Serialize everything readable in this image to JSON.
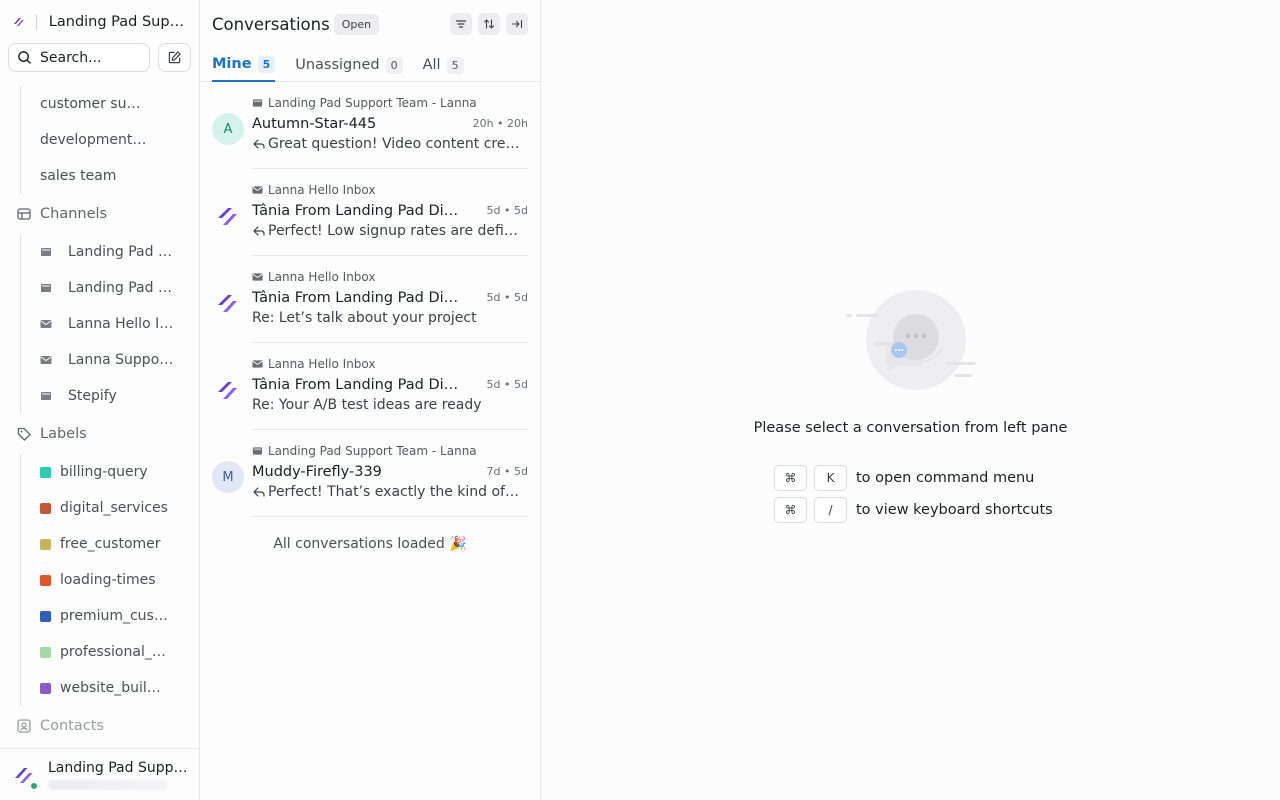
{
  "brand": {
    "name": "Landing Pad Support"
  },
  "search": {
    "placeholder": "Search..."
  },
  "sidebar": {
    "teams": [
      "customer support",
      "development team",
      "sales team"
    ],
    "channels_label": "Channels",
    "channels": [
      {
        "label": "Landing Pad Support Team",
        "icon": "widget-icon"
      },
      {
        "label": "Landing Pad Support",
        "icon": "widget-icon"
      },
      {
        "label": "Lanna Hello Inbox",
        "icon": "mail-icon"
      },
      {
        "label": "Lanna Support Inbox",
        "icon": "mail-icon"
      },
      {
        "label": "Stepify",
        "icon": "widget-icon"
      }
    ],
    "labels_label": "Labels",
    "labels": [
      {
        "label": "billing-query",
        "color": "#2ecbb1"
      },
      {
        "label": "digital_services",
        "color": "#c4573a"
      },
      {
        "label": "free_customer",
        "color": "#c9b35a"
      },
      {
        "label": "loading-times",
        "color": "#e0542b"
      },
      {
        "label": "premium_customer",
        "color": "#2f5fb8"
      },
      {
        "label": "professional_customer",
        "color": "#a6d9a2"
      },
      {
        "label": "website_builder",
        "color": "#8a5bc4"
      }
    ],
    "contacts_label": "Contacts"
  },
  "account": {
    "name": "Landing Pad Support"
  },
  "list": {
    "title": "Conversations",
    "status_badge": "Open",
    "tabs": [
      {
        "label": "Mine",
        "count": "5"
      },
      {
        "label": "Unassigned",
        "count": "0"
      },
      {
        "label": "All",
        "count": "5"
      }
    ],
    "conversations": [
      {
        "avatar": "A",
        "avatar_type": "letter",
        "inbox": "Landing Pad Support Team - Lanna",
        "inbox_icon": "widget-icon",
        "name": "Autumn-Star-445",
        "time": "20h • 20h",
        "reply": true,
        "message": "Great question! Video content creation for landing pages"
      },
      {
        "avatar": "",
        "avatar_type": "logo",
        "inbox": "Lanna Hello Inbox",
        "inbox_icon": "mail-icon",
        "name": "Tânia From Landing Pad Digital",
        "time": "5d • 5d",
        "reply": true,
        "message": "Perfect! Low signup rates are definitely fixable"
      },
      {
        "avatar": "",
        "avatar_type": "logo",
        "inbox": "Lanna Hello Inbox",
        "inbox_icon": "mail-icon",
        "name": "Tânia From Landing Pad Digital",
        "time": "5d • 5d",
        "reply": false,
        "message": "Re: Let’s talk about your project"
      },
      {
        "avatar": "",
        "avatar_type": "logo",
        "inbox": "Lanna Hello Inbox",
        "inbox_icon": "mail-icon",
        "name": "Tânia From Landing Pad Digital",
        "time": "5d • 5d",
        "reply": false,
        "message": "Re: Your A/B test ideas are ready"
      },
      {
        "avatar": "M",
        "avatar_type": "letter",
        "inbox": "Landing Pad Support Team - Lanna",
        "inbox_icon": "widget-icon",
        "name": "Muddy-Firefly-339",
        "time": "7d • 5d",
        "reply": true,
        "message": "Perfect! That’s exactly the kind of thing we can help with"
      }
    ],
    "loaded_text": "All conversations loaded 🎉"
  },
  "empty": {
    "message": "Please select a conversation from left pane",
    "shortcuts": [
      {
        "key1": "⌘",
        "key2": "K",
        "label": "to open command menu"
      },
      {
        "key1": "⌘",
        "key2": "/",
        "label": "to view keyboard shortcuts"
      }
    ]
  }
}
